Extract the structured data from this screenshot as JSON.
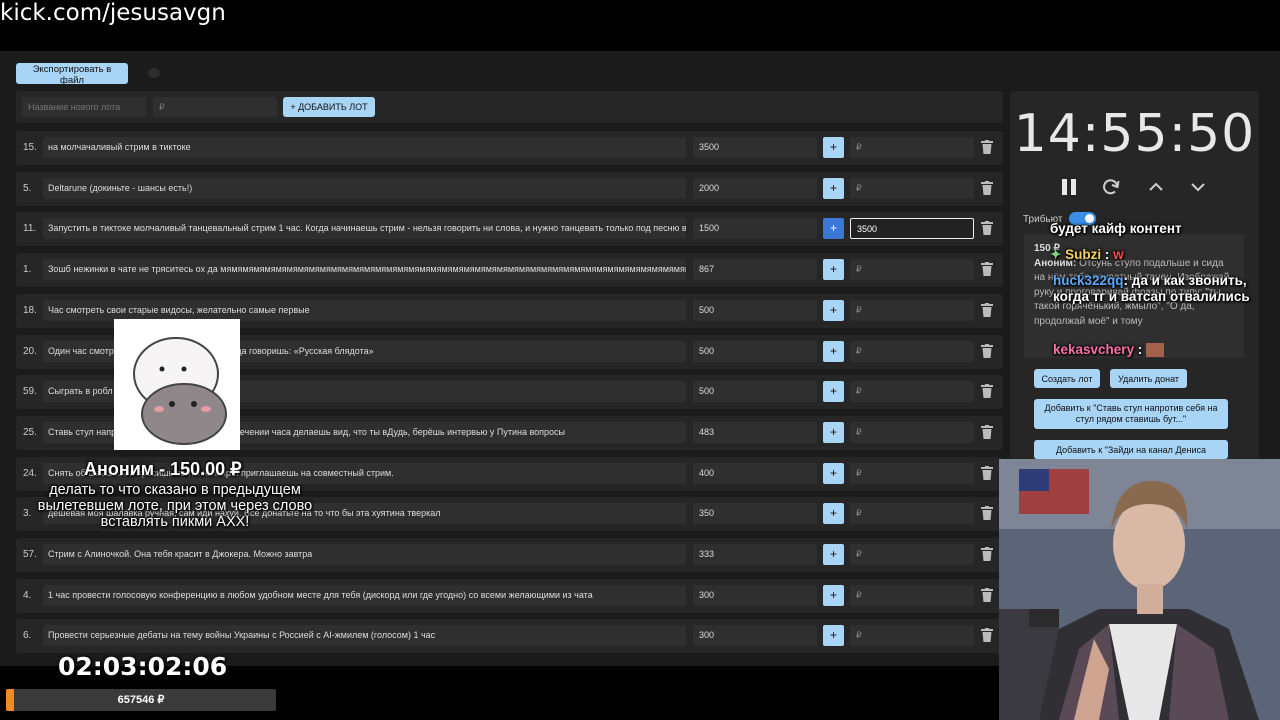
{
  "browser": {
    "url": "kick.com/jesusavgn"
  },
  "toolbar": {
    "export_label": "Экспортировать в файл"
  },
  "new_lot": {
    "name_placeholder": "Название нового лота",
    "amount_placeholder": "₽",
    "add_label": "+ ДОБАВИТЬ ЛОТ"
  },
  "lots": [
    {
      "num": "15.",
      "name": "на молчачаливый стрим в тиктоке",
      "amount": "3500",
      "extra": "₽"
    },
    {
      "num": "5.",
      "name": "Deltarune (докиньте - шансы есть!)",
      "amount": "2000",
      "extra": "₽"
    },
    {
      "num": "11.",
      "name": "Запустить в тиктоке молчаливый танцевальный стрим 1 час. Когда начинаешь стрим - нельзя говорить ни слова, и нужно танцевать только под песню в",
      "amount": "1500",
      "extra": "3500"
    },
    {
      "num": "1.",
      "name": "Зошб нежинки в чате не тряситесь ох да мямямямямямямямямямямямямямямямямямямямямямямямямямямямямямямямямямямямямямямямямямямям",
      "amount": "867",
      "extra": "₽"
    },
    {
      "num": "18.",
      "name": "Час смотреть свои старые видосы, желательно самые первые",
      "amount": "500",
      "extra": "₽"
    },
    {
      "num": "20.",
      "name": "Один час смотр                                 ешь лютую базу, только иногда говоришь: «Русская блядота»",
      "amount": "500",
      "extra": "₽"
    },
    {
      "num": "59.",
      "name": "Сыграть в робл                                   длисчиков",
      "amount": "500",
      "extra": "₽"
    },
    {
      "num": "25.",
      "name": "Ставь стул напр                                  ишь бутылку или игрушку.В течении часа делаешь вид, что ты вДудь, берёшь интервью у Путина вопросы",
      "amount": "483",
      "extra": "₽"
    },
    {
      "num": "24.",
      "name": "Снять об                                                   шаешься и просишь пойти на мир и приглашаешь на совместный стрим.",
      "amount": "400",
      "extra": "₽"
    },
    {
      "num": "3.",
      "name": "                                                               дешевая моя шалавка ручная, сам иди нахуй. Все донатьте на то что бы эта хуятина тверкал",
      "amount": "350",
      "extra": "₽"
    },
    {
      "num": "57.",
      "name": "Стрим с Алиночкой. Она тебя красит в Джокера. Можно завтра",
      "amount": "333",
      "extra": "₽"
    },
    {
      "num": "4.",
      "name": "1 час провести голосовую конференцию в любом удобном месте для тебя (дискорд или где угодно) со всеми желающими из чата",
      "amount": "300",
      "extra": "₽"
    },
    {
      "num": "6.",
      "name": "Провести серьезные дебаты на тему войны Украины с Россией с AI-жмилем (голосом) 1 час",
      "amount": "300",
      "extra": "₽"
    }
  ],
  "timer": {
    "time": "14:55:50",
    "tribute_label": "Трибьют"
  },
  "donation_panel": {
    "amount": "150 ₽",
    "author": "Аноним:",
    "text": "Отсунь стуло подальше и сида на нём тебя приватный танец. Изображай руку и проговаривай фразы по типу: \"ты такой горячёнький, жмыло\", \"О да, продолжай моё\" и тому"
  },
  "donation_buttons": {
    "create": "Создать лот",
    "delete": "Удалить донат",
    "add1": "Добавить к \"Ставь стул напротив себя на стул рядом ставишь бут...\"",
    "add2": "Добавить к \"Зайди на канал Дениса"
  },
  "chat": {
    "top_fragment": "будет кайф контент",
    "msg1_user": "Subzi",
    "msg1_text": "w",
    "msg2_user": "huck322qq",
    "msg2_text": ": да и как звонить, когда тг и ватсап отвалились",
    "msg3_user": "kekasvchery",
    "user_colors": {
      "subzi": "#f4d35e",
      "huck": "#5aa9ff",
      "kekas": "#ff6fa8"
    }
  },
  "alert": {
    "title": "Аноним - 150.00 ₽",
    "message": "делать то что сказано в предыдущем вылетевшем лоте, при этом через слово вставлять пикми АХХ!"
  },
  "countdown": "02:03:02:06",
  "goal": {
    "label": "657546 ₽",
    "progress": 0.03
  }
}
